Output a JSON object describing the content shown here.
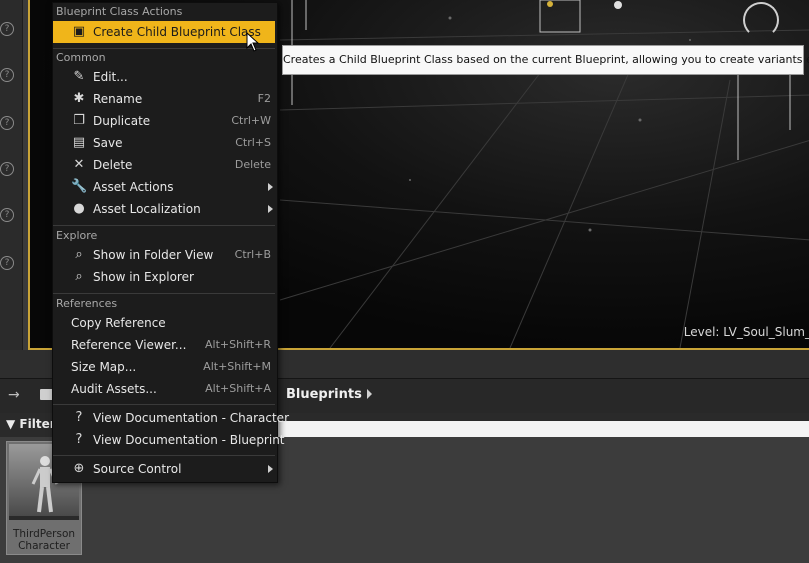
{
  "viewport": {
    "level_label": "Level:  LV_Soul_Slum_"
  },
  "context_menu": {
    "sections": {
      "blueprint_class_actions": "Blueprint Class Actions",
      "common": "Common",
      "explore": "Explore",
      "references": "References"
    },
    "items": {
      "create_child": {
        "label": "Create Child Blueprint Class",
        "icon": "blueprint-create-icon"
      },
      "edit": {
        "label": "Edit...",
        "icon": "edit-icon"
      },
      "rename": {
        "label": "Rename",
        "shortcut": "F2",
        "icon": "rename-icon"
      },
      "duplicate": {
        "label": "Duplicate",
        "shortcut": "Ctrl+W",
        "icon": "duplicate-icon"
      },
      "save": {
        "label": "Save",
        "shortcut": "Ctrl+S",
        "icon": "save-icon"
      },
      "delete": {
        "label": "Delete",
        "shortcut": "Delete",
        "icon": "delete-icon"
      },
      "asset_actions": {
        "label": "Asset Actions",
        "icon": "wrench-icon"
      },
      "asset_localization": {
        "label": "Asset Localization",
        "icon": "globe-icon"
      },
      "show_folder_view": {
        "label": "Show in Folder View",
        "shortcut": "Ctrl+B",
        "icon": "magnifier-icon"
      },
      "show_explorer": {
        "label": "Show in Explorer",
        "icon": "magnifier-icon"
      },
      "copy_reference": {
        "label": "Copy Reference"
      },
      "reference_viewer": {
        "label": "Reference Viewer...",
        "shortcut": "Alt+Shift+R"
      },
      "size_map": {
        "label": "Size Map...",
        "shortcut": "Alt+Shift+M"
      },
      "audit_assets": {
        "label": "Audit Assets...",
        "shortcut": "Alt+Shift+A"
      },
      "view_doc_character": {
        "label": "View Documentation - Character",
        "icon": "help-icon"
      },
      "view_doc_blueprint": {
        "label": "View Documentation - Blueprint",
        "icon": "help-icon"
      },
      "source_control": {
        "label": "Source Control",
        "icon": "source-control-icon"
      }
    }
  },
  "tooltip": {
    "text": "Creates a Child Blueprint Class based on the current Blueprint, allowing you to create variants easily."
  },
  "content_browser": {
    "breadcrumb": "Blueprints",
    "filters_label": "Filters",
    "asset": {
      "name": "ThirdPerson\nCharacter"
    }
  },
  "colors": {
    "highlight": "#f0b51a",
    "viewport_border": "#c9a437"
  }
}
